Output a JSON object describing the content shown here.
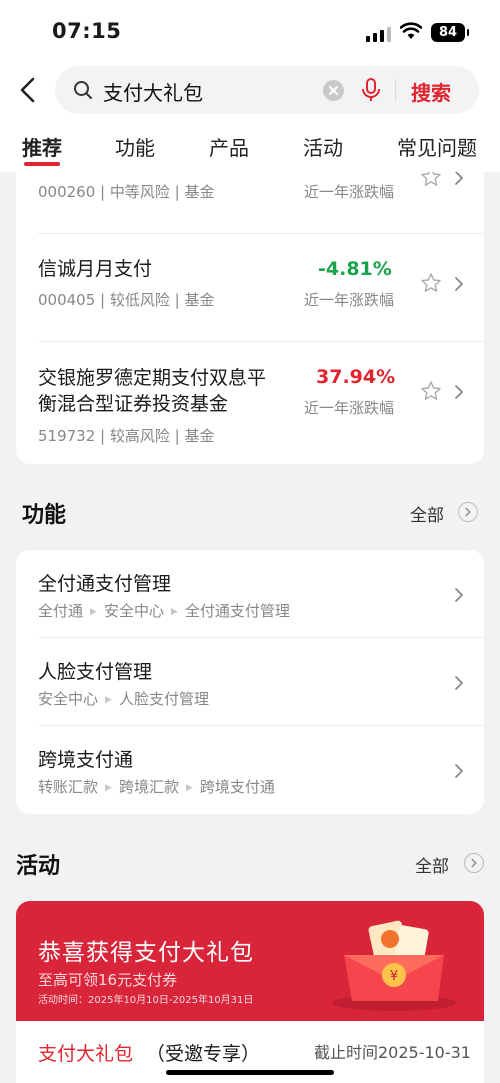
{
  "status_bar": {
    "time": "07:15",
    "battery": "84"
  },
  "search": {
    "query": "支付大礼包",
    "button": "搜索"
  },
  "tabs": [
    "推荐",
    "功能",
    "产品",
    "活动",
    "常见问题"
  ],
  "funds": [
    {
      "name": "",
      "meta": "000260 | 中等风险 | 基金",
      "rate": "",
      "rate_label": "近一年涨跌幅"
    },
    {
      "name": "信诚月月支付",
      "meta": "000405 | 较低风险 | 基金",
      "rate": "-4.81%",
      "rate_label": "近一年涨跌幅"
    },
    {
      "name_line1": "交银施罗德定期支付双息平",
      "name_line2": "衡混合型证券投资基金",
      "meta": "519732 | 较高风险 | 基金",
      "rate": "37.94%",
      "rate_label": "近一年涨跌幅"
    }
  ],
  "functions": {
    "title": "功能",
    "all": "全部",
    "items": [
      {
        "title": "全付通支付管理",
        "path": [
          "全付通",
          "安全中心",
          "全付通支付管理"
        ]
      },
      {
        "title": "人脸支付管理",
        "path": [
          "安全中心",
          "人脸支付管理"
        ]
      },
      {
        "title": "跨境支付通",
        "path": [
          "转账汇款",
          "跨境汇款",
          "跨境支付通"
        ]
      }
    ]
  },
  "activities": {
    "title": "活动",
    "all": "全部",
    "banner_title": "恭喜获得支付大礼包",
    "banner_subtitle": "至高可领16元支付券",
    "banner_date": "活动时间：2025年10月10日-2025年10月31日",
    "name": "支付大礼包",
    "tag": "（受邀专享）",
    "deadline": "截止时间2025-10-31"
  },
  "colors": {
    "accent": "#e0252f",
    "gain": "#e0252f",
    "loss": "#1aa34a",
    "banner": "#d8253a"
  }
}
